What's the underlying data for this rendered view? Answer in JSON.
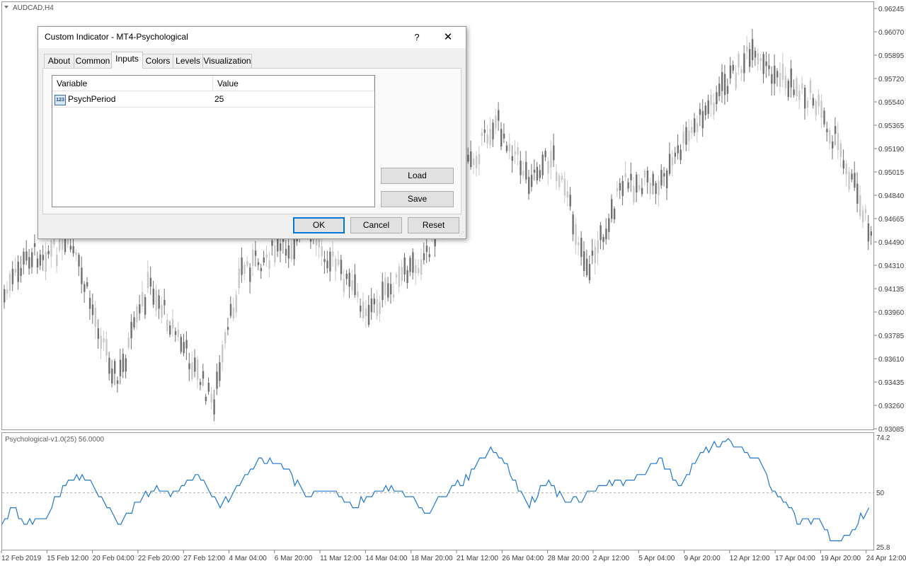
{
  "chart": {
    "symbol_label": "AUDCAD,H4",
    "indicator_label": "Psychological-v1.0(25) 56.0000",
    "price_ticks": [
      "0.96245",
      "0.96070",
      "0.95895",
      "0.95720",
      "0.95540",
      "0.95365",
      "0.95190",
      "0.95015",
      "0.94840",
      "0.94665",
      "0.94490",
      "0.94310",
      "0.94135",
      "0.93960",
      "0.93785",
      "0.93610",
      "0.93435",
      "0.93260",
      "0.93085"
    ],
    "indicator_ticks": [
      "74.2",
      "50",
      "25.8"
    ],
    "date_ticks": [
      "12 Feb 2019",
      "15 Feb 12:00",
      "20 Feb 04:00",
      "22 Feb 20:00",
      "27 Feb 12:00",
      "4 Mar 04:00",
      "6 Mar 20:00",
      "11 Mar 12:00",
      "14 Mar 04:00",
      "18 Mar 20:00",
      "21 Mar 12:00",
      "26 Mar 04:00",
      "28 Mar 20:00",
      "2 Apr 12:00",
      "5 Apr 04:00",
      "9 Apr 20:00",
      "12 Apr 12:00",
      "17 Apr 04:00",
      "19 Apr 20:00",
      "24 Apr 12:00"
    ],
    "colors": {
      "bull": "#c8c8c8",
      "bear": "#707070",
      "indicator_line": "#1e78d2",
      "level_line": "#b4b4b4",
      "frame": "#999999"
    }
  },
  "dialog": {
    "title": "Custom Indicator - MT4-Psychological",
    "help": "?",
    "close": "✕",
    "tabs": [
      "About",
      "Common",
      "Inputs",
      "Colors",
      "Levels",
      "Visualization"
    ],
    "active_tab": "Inputs",
    "table": {
      "headers": [
        "Variable",
        "Value"
      ],
      "rows": [
        {
          "icon": "integer-param-icon",
          "icon_text": "123",
          "variable": "PsychPeriod",
          "value": "25"
        }
      ]
    },
    "buttons": {
      "load": "Load",
      "save": "Save",
      "ok": "OK",
      "cancel": "Cancel",
      "reset": "Reset"
    }
  }
}
